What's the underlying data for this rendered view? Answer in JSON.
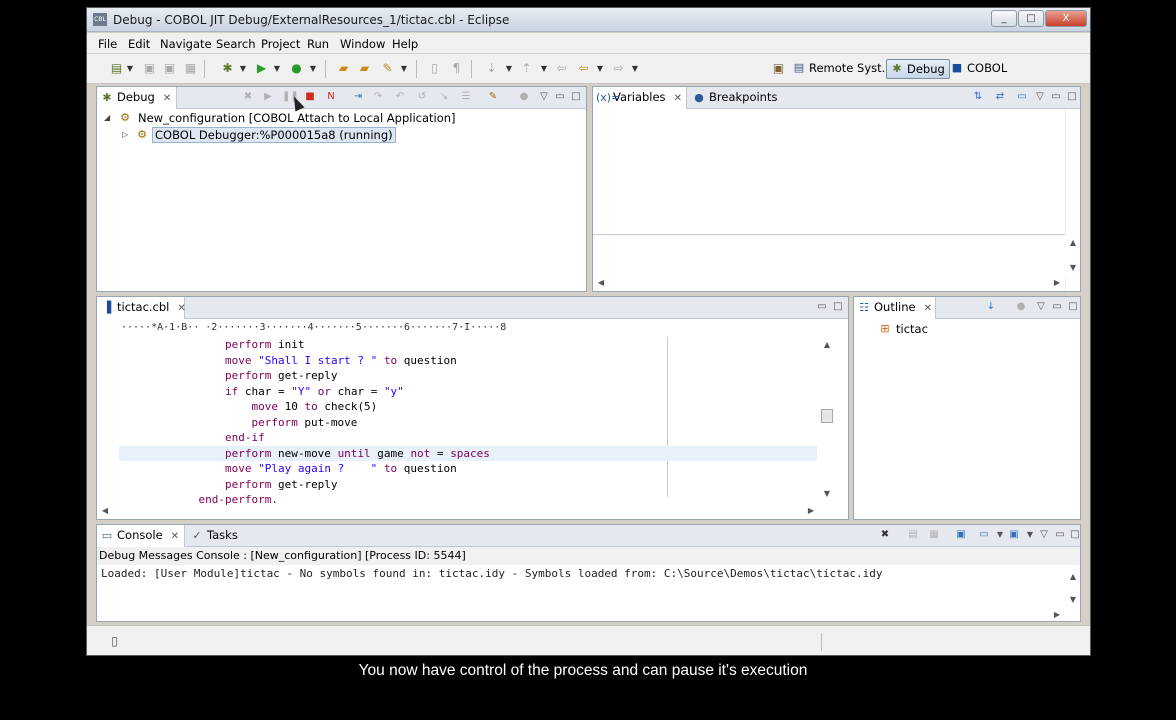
{
  "window": {
    "title": "Debug - COBOL JIT Debug/ExternalResources_1/tictac.cbl - Eclipse",
    "app_icon_text": "CBL",
    "controls": [
      "_",
      "□",
      "X"
    ]
  },
  "menu": [
    "File",
    "Edit",
    "Navigate",
    "Search",
    "Project",
    "Run",
    "Window",
    "Help"
  ],
  "perspectives": [
    {
      "label": "Remote Syst...",
      "icon": "remote-systems-icon"
    },
    {
      "label": "Debug",
      "icon": "debug-bug-icon",
      "active": true
    },
    {
      "label": "COBOL",
      "icon": "cobol-perspective-icon"
    }
  ],
  "debug_view": {
    "tab": "Debug",
    "tree": [
      {
        "label": "New_configuration [COBOL Attach to Local Application]",
        "icon": "launch-config-icon",
        "expanded": true
      },
      {
        "label": "COBOL Debugger:%P000015a8 (running)",
        "icon": "debugger-process-icon",
        "selected": true
      }
    ]
  },
  "variables_view": {
    "tabs": [
      "Variables",
      "Breakpoints"
    ]
  },
  "editor": {
    "tab": "tictac.cbl",
    "ruler": "·····*A·1·B·· ·2·······3·······4·······5·······6·······7·I·····8",
    "lines": [
      {
        "indent": "          ",
        "parts": [
          {
            "t": "perform",
            "c": "kw"
          },
          {
            "t": " init",
            "c": ""
          }
        ]
      },
      {
        "indent": "          ",
        "parts": [
          {
            "t": "move",
            "c": "kw"
          },
          {
            "t": " ",
            "c": ""
          },
          {
            "t": "\"Shall I start ? \"",
            "c": "str"
          },
          {
            "t": " ",
            "c": ""
          },
          {
            "t": "to",
            "c": "kw"
          },
          {
            "t": " question",
            "c": ""
          }
        ]
      },
      {
        "indent": "          ",
        "parts": [
          {
            "t": "perform",
            "c": "kw"
          },
          {
            "t": " get-reply",
            "c": ""
          }
        ]
      },
      {
        "indent": "          ",
        "parts": [
          {
            "t": "if",
            "c": "kw"
          },
          {
            "t": " char = ",
            "c": ""
          },
          {
            "t": "\"Y\"",
            "c": "str"
          },
          {
            "t": " ",
            "c": ""
          },
          {
            "t": "or",
            "c": "kw"
          },
          {
            "t": " char = ",
            "c": ""
          },
          {
            "t": "\"y\"",
            "c": "str"
          }
        ]
      },
      {
        "indent": "              ",
        "parts": [
          {
            "t": "move",
            "c": "kw"
          },
          {
            "t": " 10 ",
            "c": ""
          },
          {
            "t": "to",
            "c": "kw"
          },
          {
            "t": " check(5)",
            "c": ""
          }
        ]
      },
      {
        "indent": "              ",
        "parts": [
          {
            "t": "perform",
            "c": "kw"
          },
          {
            "t": " put-move",
            "c": ""
          }
        ]
      },
      {
        "indent": "          ",
        "parts": [
          {
            "t": "end-if",
            "c": "kw"
          }
        ]
      },
      {
        "indent": "          ",
        "parts": [
          {
            "t": "perform",
            "c": "kw"
          },
          {
            "t": " new-move ",
            "c": ""
          },
          {
            "t": "until",
            "c": "kw"
          },
          {
            "t": " game ",
            "c": ""
          },
          {
            "t": "not",
            "c": "kw"
          },
          {
            "t": " = ",
            "c": ""
          },
          {
            "t": "spaces",
            "c": "kw"
          }
        ],
        "highlight": true
      },
      {
        "indent": "          ",
        "parts": [
          {
            "t": "move",
            "c": "kw"
          },
          {
            "t": " ",
            "c": ""
          },
          {
            "t": "\"Play again ?    \"",
            "c": "str"
          },
          {
            "t": " ",
            "c": ""
          },
          {
            "t": "to",
            "c": "kw"
          },
          {
            "t": " question",
            "c": ""
          }
        ]
      },
      {
        "indent": "          ",
        "parts": [
          {
            "t": "perform",
            "c": "kw"
          },
          {
            "t": " get-reply",
            "c": ""
          }
        ]
      },
      {
        "indent": "      ",
        "parts": [
          {
            "t": "end-perform.",
            "c": "kw"
          }
        ]
      }
    ]
  },
  "outline_view": {
    "tab": "Outline",
    "items": [
      "tictac"
    ]
  },
  "console_view": {
    "tabs": [
      "Console",
      "Tasks"
    ],
    "header": "Debug Messages Console : [New_configuration] [Process ID: 5544]",
    "output": "Loaded: [User Module]tictac - No symbols found in: tictac.idy - Symbols loaded from: C:\\Source\\Demos\\tictac\\tictac.idy"
  },
  "caption": "You now have control of the process and can pause it's execution"
}
